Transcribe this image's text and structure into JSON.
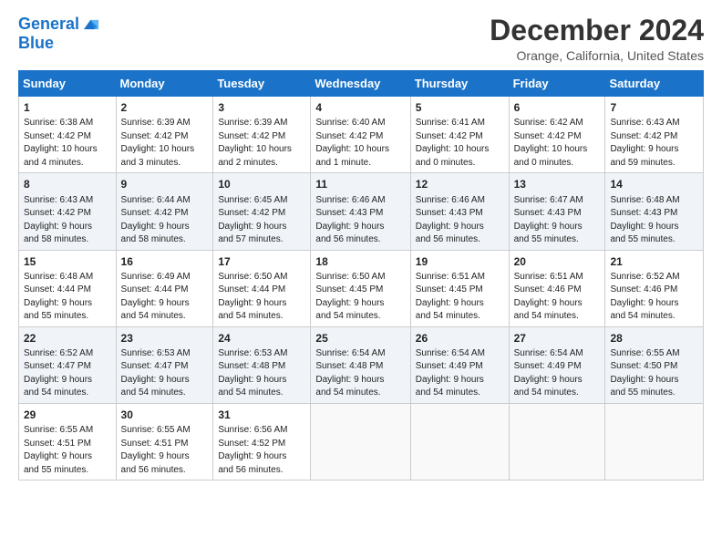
{
  "header": {
    "logo_line1": "General",
    "logo_line2": "Blue",
    "month": "December 2024",
    "location": "Orange, California, United States"
  },
  "days_of_week": [
    "Sunday",
    "Monday",
    "Tuesday",
    "Wednesday",
    "Thursday",
    "Friday",
    "Saturday"
  ],
  "weeks": [
    [
      {
        "day": "1",
        "info": "Sunrise: 6:38 AM\nSunset: 4:42 PM\nDaylight: 10 hours\nand 4 minutes."
      },
      {
        "day": "2",
        "info": "Sunrise: 6:39 AM\nSunset: 4:42 PM\nDaylight: 10 hours\nand 3 minutes."
      },
      {
        "day": "3",
        "info": "Sunrise: 6:39 AM\nSunset: 4:42 PM\nDaylight: 10 hours\nand 2 minutes."
      },
      {
        "day": "4",
        "info": "Sunrise: 6:40 AM\nSunset: 4:42 PM\nDaylight: 10 hours\nand 1 minute."
      },
      {
        "day": "5",
        "info": "Sunrise: 6:41 AM\nSunset: 4:42 PM\nDaylight: 10 hours\nand 0 minutes."
      },
      {
        "day": "6",
        "info": "Sunrise: 6:42 AM\nSunset: 4:42 PM\nDaylight: 10 hours\nand 0 minutes."
      },
      {
        "day": "7",
        "info": "Sunrise: 6:43 AM\nSunset: 4:42 PM\nDaylight: 9 hours\nand 59 minutes."
      }
    ],
    [
      {
        "day": "8",
        "info": "Sunrise: 6:43 AM\nSunset: 4:42 PM\nDaylight: 9 hours\nand 58 minutes."
      },
      {
        "day": "9",
        "info": "Sunrise: 6:44 AM\nSunset: 4:42 PM\nDaylight: 9 hours\nand 58 minutes."
      },
      {
        "day": "10",
        "info": "Sunrise: 6:45 AM\nSunset: 4:42 PM\nDaylight: 9 hours\nand 57 minutes."
      },
      {
        "day": "11",
        "info": "Sunrise: 6:46 AM\nSunset: 4:43 PM\nDaylight: 9 hours\nand 56 minutes."
      },
      {
        "day": "12",
        "info": "Sunrise: 6:46 AM\nSunset: 4:43 PM\nDaylight: 9 hours\nand 56 minutes."
      },
      {
        "day": "13",
        "info": "Sunrise: 6:47 AM\nSunset: 4:43 PM\nDaylight: 9 hours\nand 55 minutes."
      },
      {
        "day": "14",
        "info": "Sunrise: 6:48 AM\nSunset: 4:43 PM\nDaylight: 9 hours\nand 55 minutes."
      }
    ],
    [
      {
        "day": "15",
        "info": "Sunrise: 6:48 AM\nSunset: 4:44 PM\nDaylight: 9 hours\nand 55 minutes."
      },
      {
        "day": "16",
        "info": "Sunrise: 6:49 AM\nSunset: 4:44 PM\nDaylight: 9 hours\nand 54 minutes."
      },
      {
        "day": "17",
        "info": "Sunrise: 6:50 AM\nSunset: 4:44 PM\nDaylight: 9 hours\nand 54 minutes."
      },
      {
        "day": "18",
        "info": "Sunrise: 6:50 AM\nSunset: 4:45 PM\nDaylight: 9 hours\nand 54 minutes."
      },
      {
        "day": "19",
        "info": "Sunrise: 6:51 AM\nSunset: 4:45 PM\nDaylight: 9 hours\nand 54 minutes."
      },
      {
        "day": "20",
        "info": "Sunrise: 6:51 AM\nSunset: 4:46 PM\nDaylight: 9 hours\nand 54 minutes."
      },
      {
        "day": "21",
        "info": "Sunrise: 6:52 AM\nSunset: 4:46 PM\nDaylight: 9 hours\nand 54 minutes."
      }
    ],
    [
      {
        "day": "22",
        "info": "Sunrise: 6:52 AM\nSunset: 4:47 PM\nDaylight: 9 hours\nand 54 minutes."
      },
      {
        "day": "23",
        "info": "Sunrise: 6:53 AM\nSunset: 4:47 PM\nDaylight: 9 hours\nand 54 minutes."
      },
      {
        "day": "24",
        "info": "Sunrise: 6:53 AM\nSunset: 4:48 PM\nDaylight: 9 hours\nand 54 minutes."
      },
      {
        "day": "25",
        "info": "Sunrise: 6:54 AM\nSunset: 4:48 PM\nDaylight: 9 hours\nand 54 minutes."
      },
      {
        "day": "26",
        "info": "Sunrise: 6:54 AM\nSunset: 4:49 PM\nDaylight: 9 hours\nand 54 minutes."
      },
      {
        "day": "27",
        "info": "Sunrise: 6:54 AM\nSunset: 4:49 PM\nDaylight: 9 hours\nand 54 minutes."
      },
      {
        "day": "28",
        "info": "Sunrise: 6:55 AM\nSunset: 4:50 PM\nDaylight: 9 hours\nand 55 minutes."
      }
    ],
    [
      {
        "day": "29",
        "info": "Sunrise: 6:55 AM\nSunset: 4:51 PM\nDaylight: 9 hours\nand 55 minutes."
      },
      {
        "day": "30",
        "info": "Sunrise: 6:55 AM\nSunset: 4:51 PM\nDaylight: 9 hours\nand 56 minutes."
      },
      {
        "day": "31",
        "info": "Sunrise: 6:56 AM\nSunset: 4:52 PM\nDaylight: 9 hours\nand 56 minutes."
      },
      {
        "day": "",
        "info": ""
      },
      {
        "day": "",
        "info": ""
      },
      {
        "day": "",
        "info": ""
      },
      {
        "day": "",
        "info": ""
      }
    ]
  ]
}
